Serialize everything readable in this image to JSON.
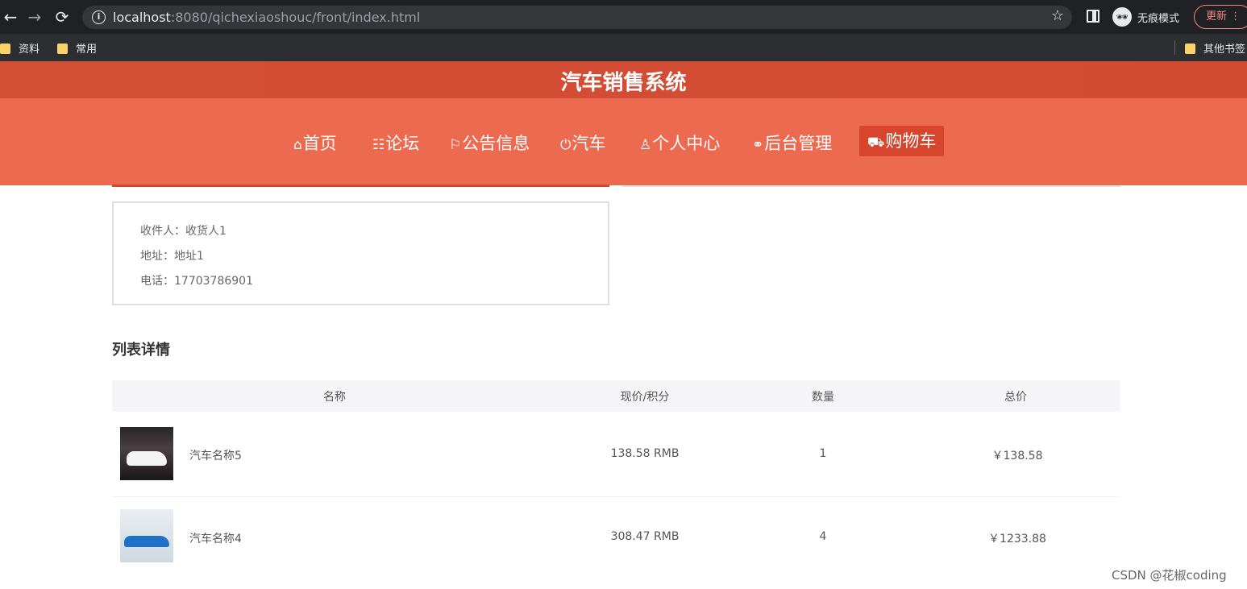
{
  "browser": {
    "url_host": "localhost",
    "url_rest": ":8080/qichexiaoshouc/front/index.html",
    "incognito_label": "无痕模式",
    "update_label": "更新",
    "bookmarks": [
      "资料",
      "常用"
    ],
    "other_bookmarks": "其他书签"
  },
  "site": {
    "title": "汽车销售系统",
    "nav": [
      {
        "icon": "⌂",
        "label": "首页"
      },
      {
        "icon": "☷",
        "label": "论坛"
      },
      {
        "icon": "⚐",
        "label": "公告信息"
      },
      {
        "icon": "⏻",
        "label": "汽车"
      },
      {
        "icon": "♙",
        "label": "个人中心"
      },
      {
        "icon": "⚭",
        "label": "后台管理"
      },
      {
        "icon": "⛟",
        "label": "购物车"
      }
    ]
  },
  "address": {
    "receiver": "收件人：收货人1",
    "addr": "地址：地址1",
    "phone": "电话：17703786901"
  },
  "list": {
    "title": "列表详情",
    "headers": [
      "名称",
      "现价/积分",
      "数量",
      "总价"
    ],
    "rows": [
      {
        "name": "汽车名称5",
        "price": "138.58 RMB",
        "qty": "1",
        "total": "￥138.58"
      },
      {
        "name": "汽车名称4",
        "price": "308.47 RMB",
        "qty": "4",
        "total": "￥1233.88"
      }
    ]
  },
  "watermark": "CSDN @花椒coding"
}
